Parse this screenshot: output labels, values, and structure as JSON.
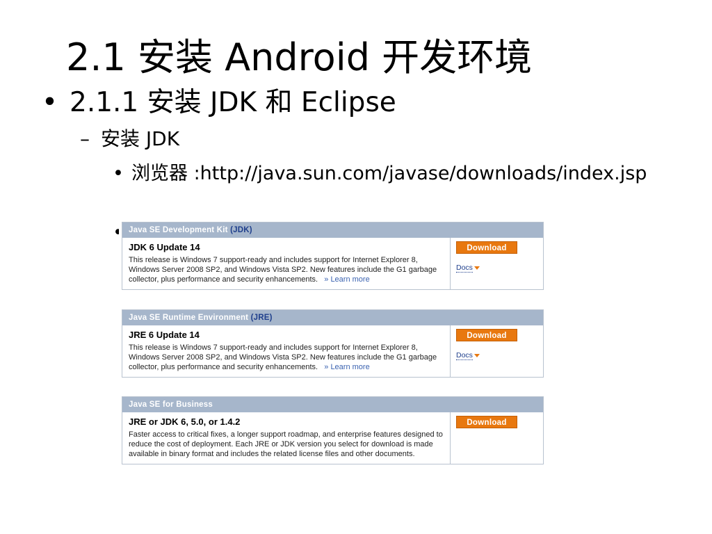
{
  "slide": {
    "title": "2.1  安装 Android 开发环境",
    "bullet1": "2.1.1  安装 JDK 和 Eclipse",
    "bullet2_mark": "–",
    "bullet2": "安装 JDK",
    "bullet3": "浏览器 :http://java.sun.com/javase/downloads/index.jsp",
    "bullet_mark": "•"
  },
  "download_page": {
    "sections": [
      {
        "header": "Java SE Development Kit",
        "header_tag": "(JDK)",
        "title": "JDK 6 Update 14",
        "description": "This release is Windows 7 support-ready and includes support for Internet Explorer 8, Windows Server 2008 SP2, and Windows Vista SP2. New features include the G1 garbage collector, plus performance and security enhancements.",
        "learn_more": "» Learn more",
        "download_label": "Download",
        "docs_label": "Docs"
      },
      {
        "header": "Java SE Runtime Environment",
        "header_tag": "(JRE)",
        "title": "JRE 6 Update 14",
        "description": "This release is Windows 7 support-ready and includes support for Internet Explorer 8, Windows Server 2008 SP2, and Windows Vista SP2. New features include the G1 garbage collector, plus performance and security enhancements.",
        "learn_more": "» Learn more",
        "download_label": "Download",
        "docs_label": "Docs"
      },
      {
        "header": "Java SE for Business",
        "title": "JRE or JDK 6, 5.0, or 1.4.2",
        "description": "Faster access to critical fixes, a longer support roadmap, and enterprise features designed to reduce the cost of deployment. Each JRE or JDK version you select for download is made available in binary format and includes the related license files and other documents.",
        "download_label": "Download"
      }
    ]
  }
}
